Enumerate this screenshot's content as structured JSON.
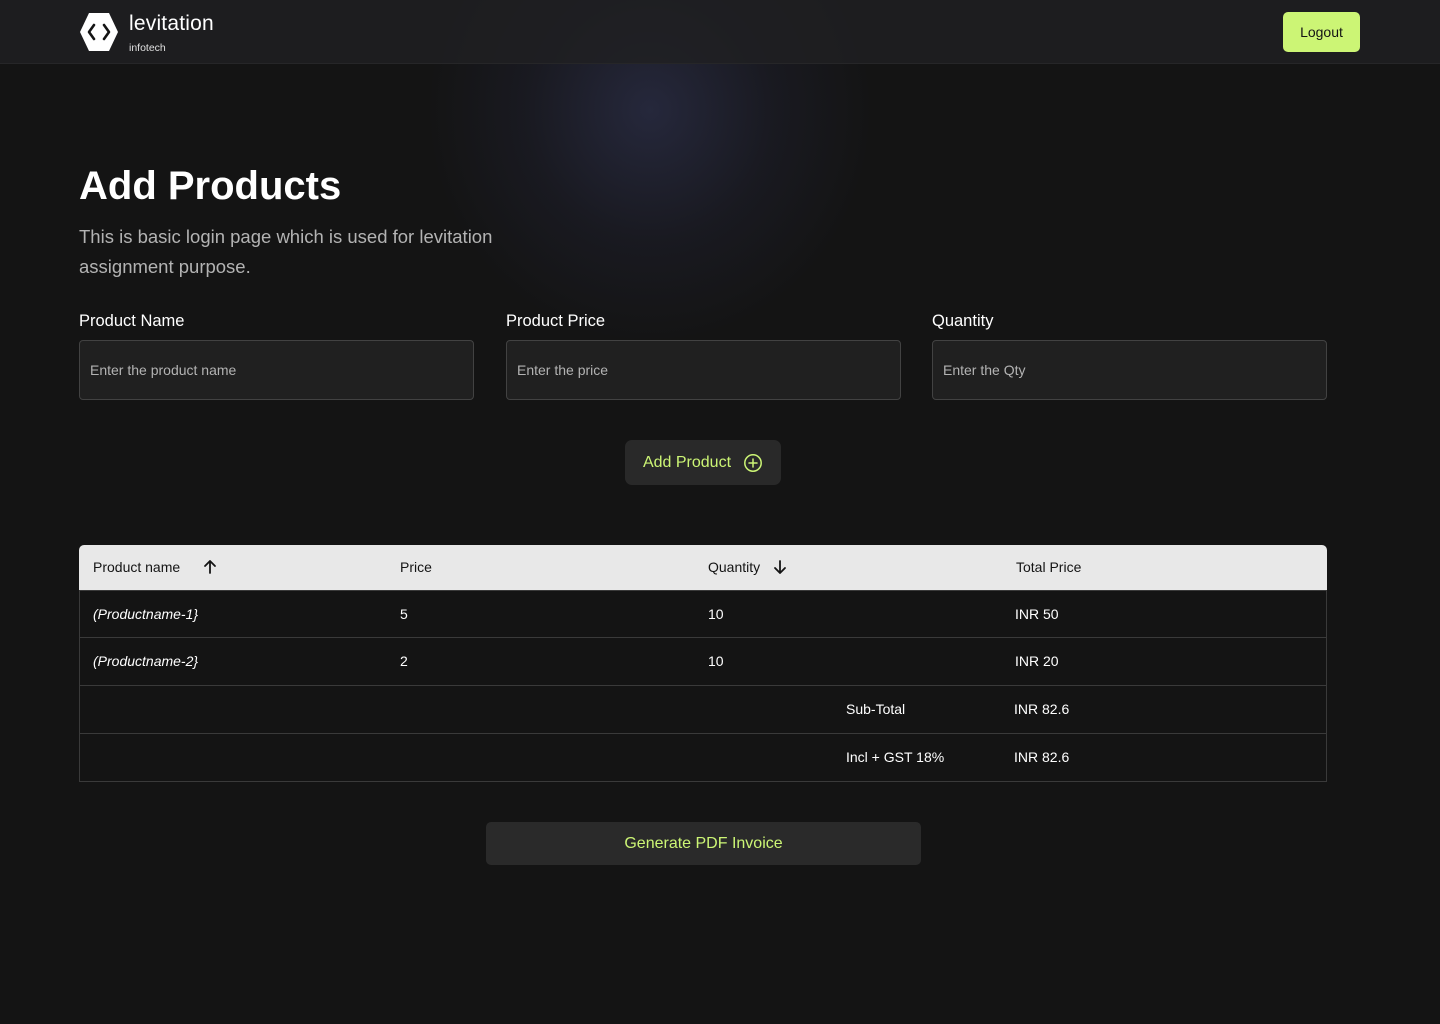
{
  "header": {
    "brand_name": "levitation",
    "brand_sub": "infotech",
    "logout_label": "Logout",
    "accent_color": "#ccf575"
  },
  "main": {
    "title": "Add Products",
    "subtitle": "This is basic login page which is used for levitation assignment purpose."
  },
  "form": {
    "fields": [
      {
        "label": "Product Name",
        "placeholder": "Enter the product name",
        "value": ""
      },
      {
        "label": "Product Price",
        "placeholder": "Enter the price",
        "value": ""
      },
      {
        "label": "Quantity",
        "placeholder": "Enter the Qty",
        "value": ""
      }
    ],
    "add_button_label": "Add Product",
    "add_button_icon": "plus-circle-icon"
  },
  "table": {
    "columns": [
      {
        "label": "Product name",
        "sort_icon": "arrow-up-icon"
      },
      {
        "label": "Price"
      },
      {
        "label": "Quantity",
        "sort_icon": "arrow-down-icon"
      },
      {
        "label": "Total Price"
      }
    ],
    "rows": [
      {
        "name": "(Productname-1}",
        "price": "5",
        "quantity": "10",
        "total": "INR 50"
      },
      {
        "name": "(Productname-2}",
        "price": "2",
        "quantity": "10",
        "total": "INR 20"
      }
    ],
    "summary": [
      {
        "label": "Sub-Total",
        "value": "INR 82.6"
      },
      {
        "label": "Incl + GST 18%",
        "value": "INR 82.6"
      }
    ]
  },
  "generate_pdf_label": "Generate PDF Invoice"
}
